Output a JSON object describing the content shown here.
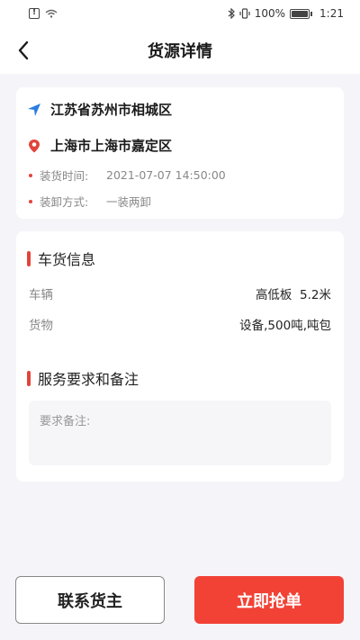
{
  "status_bar": {
    "battery_text": "100%",
    "time": "1:21",
    "battery_level": 1.0
  },
  "header": {
    "title": "货源详情"
  },
  "route": {
    "from": "江苏省苏州市相城区",
    "to": "上海市上海市嘉定区",
    "load_time_label": "装货时间:",
    "load_time_value": "2021-07-07 14:50:00",
    "load_mode_label": "装卸方式:",
    "load_mode_value": "一装两卸"
  },
  "cargo_info": {
    "title": "车货信息",
    "vehicle_label": "车辆",
    "vehicle_value": "高低板  5.2米",
    "goods_label": "货物",
    "goods_value": "设备,500吨,吨包"
  },
  "service": {
    "title": "服务要求和备注",
    "remark_placeholder": "要求备注:"
  },
  "actions": {
    "contact_label": "联系货主",
    "grab_label": "立即抢单"
  },
  "colors": {
    "accent": "#f24236",
    "navigation_icon": "#2a7de1"
  }
}
